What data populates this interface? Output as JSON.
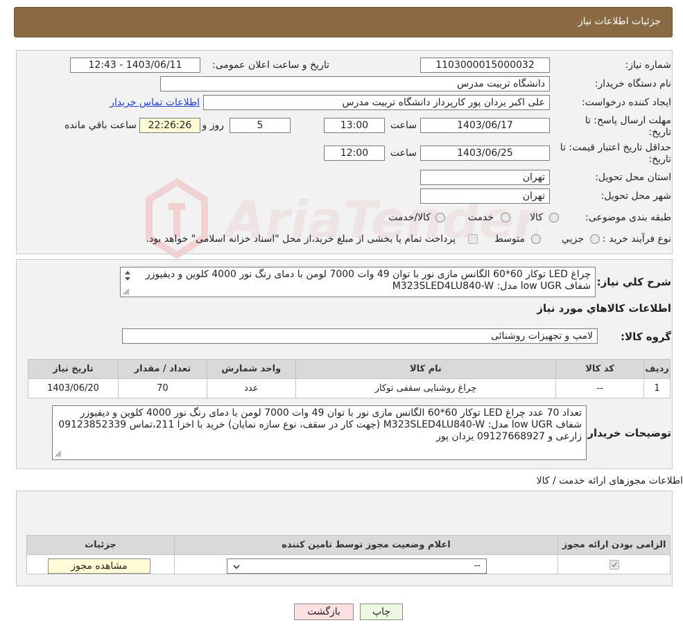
{
  "header": {
    "title": "جزئیات اطلاعات نیاز"
  },
  "info": {
    "need_number_label": "شماره نیاز:",
    "need_number": "1103000015000032",
    "announce_label": "تاریخ و ساعت اعلان عمومی:",
    "announce_value": "1403/06/11 - 12:43",
    "buyer_org_label": "نام دستگاه خریدار:",
    "buyer_org": "دانشگاه تربیت مدرس",
    "requester_label": "ایجاد کننده درخواست:",
    "requester": "علی اکبر یزدان پور کارپرداز دانشگاه تربیت مدرس",
    "contact_link": "اطلاعات تماس خریدار",
    "deadline_label_1": "مهلت ارسال پاسخ: تا",
    "deadline_label_2": "تاریخ:",
    "deadline_date": "1403/06/17",
    "time_label": "ساعت",
    "deadline_time": "13:00",
    "days_value": "5",
    "days_label": "روز و",
    "remaining_time": "22:26:26",
    "remaining_label": "ساعت باقي مانده",
    "validity_label_1": "حداقل تاریخ اعتبار قیمت: تا",
    "validity_label_2": "تاریخ:",
    "validity_date": "1403/06/25",
    "validity_time": "12:00",
    "province_label": "استان محل تحویل:",
    "province": "تهران",
    "city_label": "شهر محل تحویل:",
    "city": "تهران",
    "category_label": "طبقه بندی موضوعی:",
    "category_options": [
      "کالا",
      "خدمت",
      "کالا/خدمت"
    ],
    "process_label": "نوع فرآیند خرید :",
    "process_options": [
      "جزيي",
      "متوسط"
    ],
    "process_note": "پرداخت تمام یا بخشی از مبلغ خرید،از محل \"اسناد خزانه اسلامی\" خواهد بود."
  },
  "description": {
    "label": "شرح كلي نياز:",
    "line1": "چراغ LED توکار 60*60 الگانس مازی نور با توان 49 وات 7000 لومن با دمای رنگ نور 4000 کلوین و دیفیوزر",
    "line2": "شفاف low UGR مدل: M323SLED4LU840-W"
  },
  "goods": {
    "section_title": "اطلاعات كالاهاي مورد نياز",
    "group_label": "گروه کالا:",
    "group_value": "لامپ و تجهیزات روشنائی",
    "columns": [
      "رديف",
      "کد کالا",
      "نام کالا",
      "واحد شمارش",
      "تعداد / مقدار",
      "تاریخ نیاز"
    ],
    "rows": [
      {
        "row": "1",
        "code": "--",
        "name": "چراغ روشنایی سقفی توکار",
        "unit": "عدد",
        "qty": "70",
        "date": "1403/06/20"
      }
    ]
  },
  "buyer_notes": {
    "label": "توضیحات خریدار:",
    "line1": "تعداد 70 عدد چراغ LED توکار 60*60 الگانس مازی نور با توان 49 وات 7000 لومن با دمای رنگ نور 4000 کلوین و دیفیوزر",
    "line2": "شفاف low UGR مدل: M323SLED4LU840-W  (جهت کار در سقف، نوع سازه نمایان) خرید با اخزا 211،تماس 09123852339",
    "line3": "زارعی و 09127668927 یزدان پور"
  },
  "licenses": {
    "section_title": "اطلاعات مجوزهای ارائه خدمت / کالا",
    "columns": [
      "الزامی بودن ارائه مجوز",
      "اعلام وضعیت مجوز توسط تامین کننده",
      "جزئیات"
    ],
    "select_value": "--",
    "view_button": "مشاهده مجوز"
  },
  "actions": {
    "print": "چاپ",
    "back": "بازگشت"
  },
  "colors": {
    "header_bg": "#8a6a42",
    "panel_bg": "#f2f2f2",
    "remaining_bg": "#fffbd5",
    "back_bg": "#fde0e0",
    "print_bg": "#eaf9e0"
  },
  "watermark_text": "AriaTender.neT"
}
